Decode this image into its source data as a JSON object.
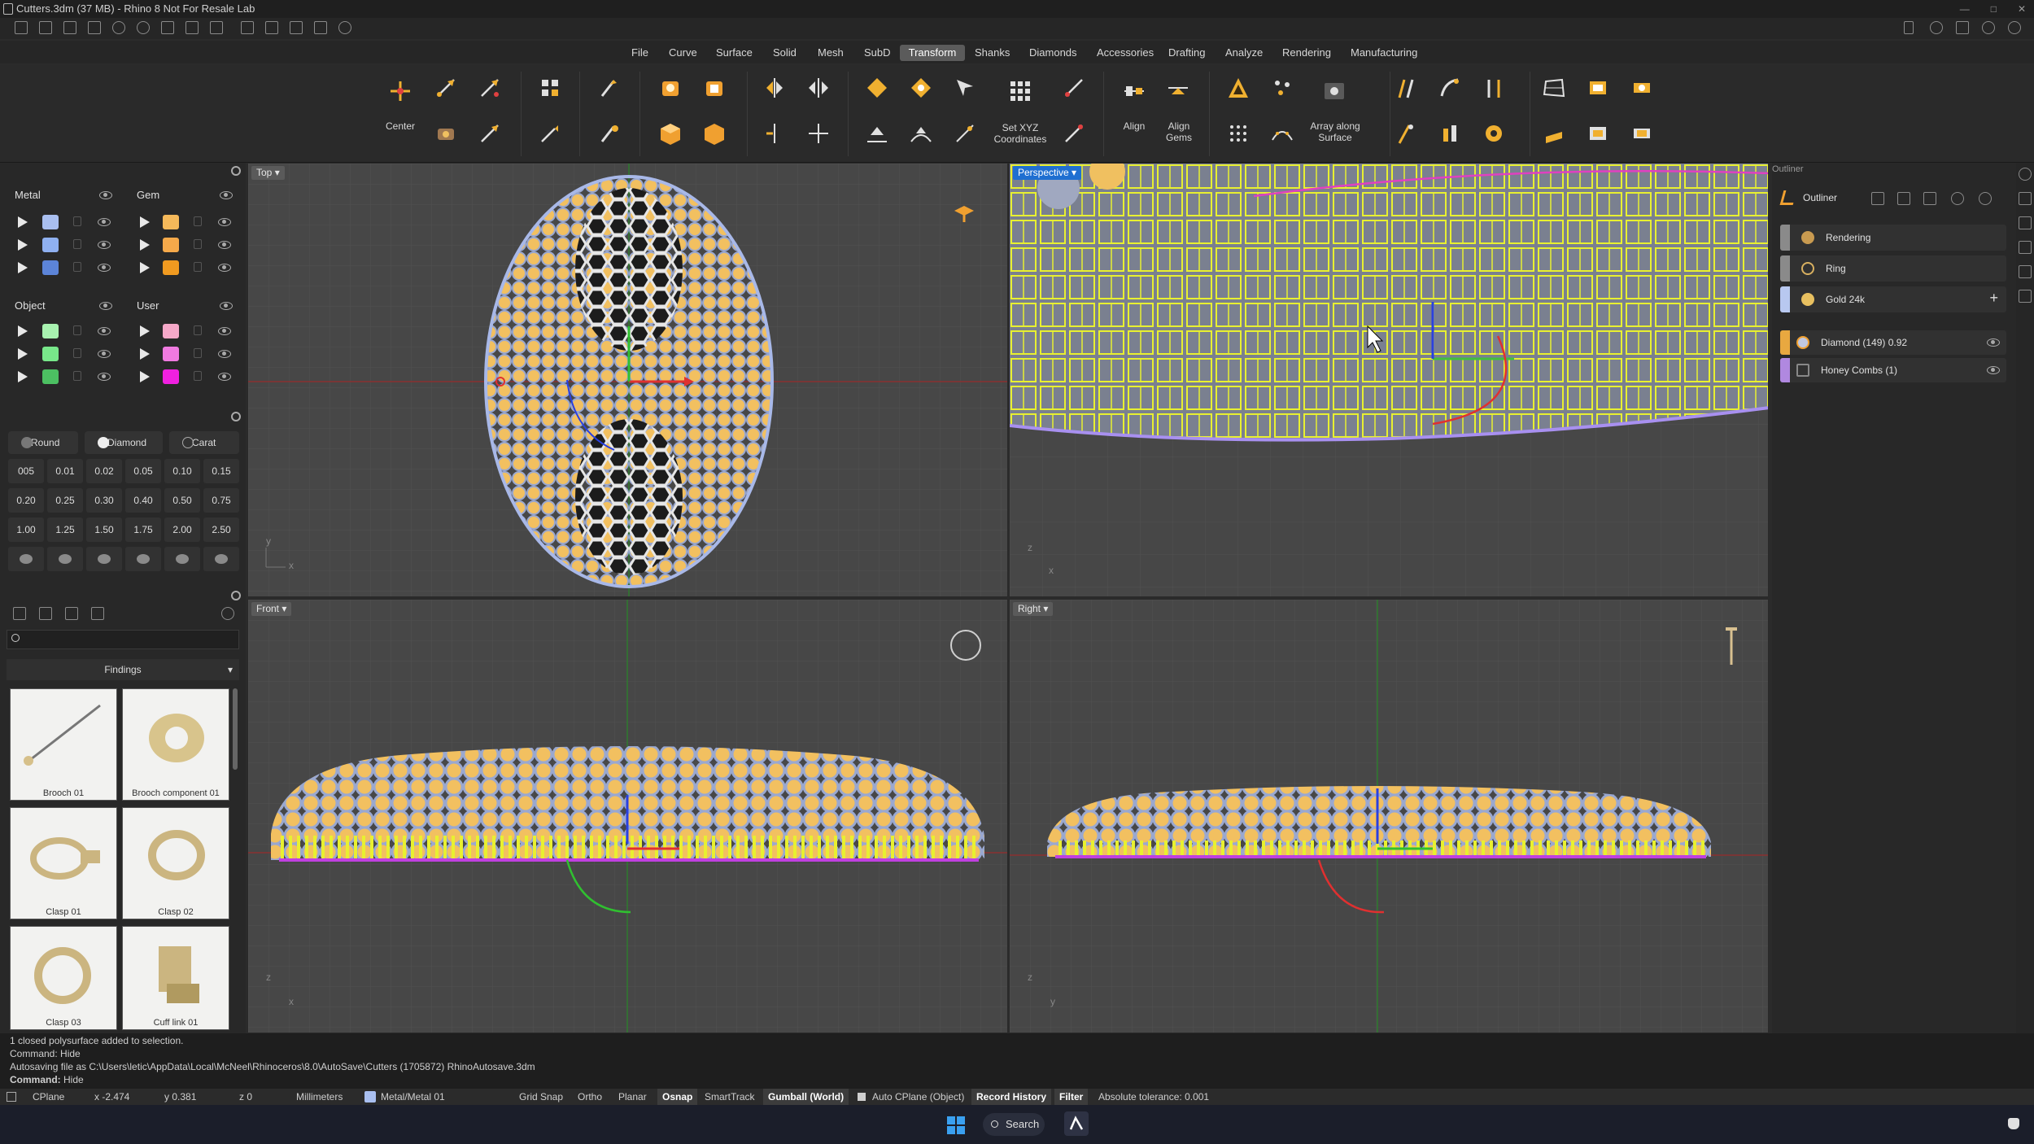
{
  "window": {
    "title": "Cutters.3dm (37 MB) - Rhino 8 Not For Resale Lab"
  },
  "menu": {
    "tabs": [
      "File",
      "Curve",
      "Surface",
      "Solid",
      "Mesh",
      "SubD",
      "Transform",
      "Shanks",
      "Diamonds",
      "Accessories",
      "Drafting",
      "Analyze",
      "Rendering",
      "Manufacturing"
    ],
    "active": "Transform"
  },
  "ribbon": {
    "center_label": "Center",
    "setxyz_label": "Set XYZ Coordinates",
    "align_label": "Align",
    "aligngems_label": "Align Gems",
    "array_label": "Array along Surface"
  },
  "layers": {
    "metal": {
      "label": "Metal",
      "colors": [
        "#a9bff0",
        "#8fb0f0",
        "#5c84d8"
      ]
    },
    "gem": {
      "label": "Gem",
      "colors": [
        "#f5b95a",
        "#f5a94a",
        "#f09a20"
      ]
    },
    "object": {
      "label": "Object",
      "colors": [
        "#a8f2b0",
        "#78e88a",
        "#4cc062"
      ]
    },
    "user": {
      "label": "User",
      "colors": [
        "#f5a8c8",
        "#f07ae0",
        "#f020e0"
      ]
    }
  },
  "gems": {
    "tabs": [
      "Round",
      "Diamond",
      "Carat"
    ],
    "sizes": [
      "005",
      "0.01",
      "0.02",
      "0.05",
      "0.10",
      "0.15",
      "0.20",
      "0.25",
      "0.30",
      "0.40",
      "0.50",
      "0.75",
      "1.00",
      "1.25",
      "1.50",
      "1.75",
      "2.00",
      "2.50"
    ]
  },
  "findings": {
    "header": "Findings",
    "items": [
      "Brooch 01",
      "Brooch component 01",
      "Clasp 01",
      "Clasp 02",
      "Clasp 03",
      "Cuff link 01"
    ]
  },
  "viewports": {
    "top": "Top",
    "perspective": "Perspective",
    "front": "Front",
    "right": "Right"
  },
  "outliner": {
    "title": "Outliner",
    "header": "Outliner",
    "items": [
      {
        "label": "Rendering",
        "color": "#8a8a8a"
      },
      {
        "label": "Ring",
        "color": "#8a8a8a"
      },
      {
        "label": "Gold 24k",
        "color": "#b8c8f0"
      },
      {
        "label": "Diamond (149) 0.92",
        "color": "#e8a840"
      },
      {
        "label": "Honey Combs (1)",
        "color": "#b088e0"
      }
    ]
  },
  "command": {
    "lines": [
      "1 closed polysurface added to selection.",
      "Command: Hide",
      "Autosaving file as C:\\Users\\letic\\AppData\\Local\\McNeel\\Rhinoceros\\8.0\\AutoSave\\Cutters (1705872) RhinoAutosave.3dm"
    ],
    "prompt_label": "Command:",
    "prompt_value": "Hide"
  },
  "status": {
    "cplane": "CPlane",
    "x": "x -2.474",
    "y": "y 0.381",
    "z": "z 0",
    "units": "Millimeters",
    "layer": "Metal/Metal 01",
    "gridsnap": "Grid Snap",
    "ortho": "Ortho",
    "planar": "Planar",
    "osnap": "Osnap",
    "smarttrack": "SmartTrack",
    "gumball": "Gumball (World)",
    "autocplane": "Auto CPlane (Object)",
    "record": "Record History",
    "filter": "Filter",
    "tolerance": "Absolute tolerance: 0.001"
  },
  "taskbar": {
    "search": "Search"
  }
}
